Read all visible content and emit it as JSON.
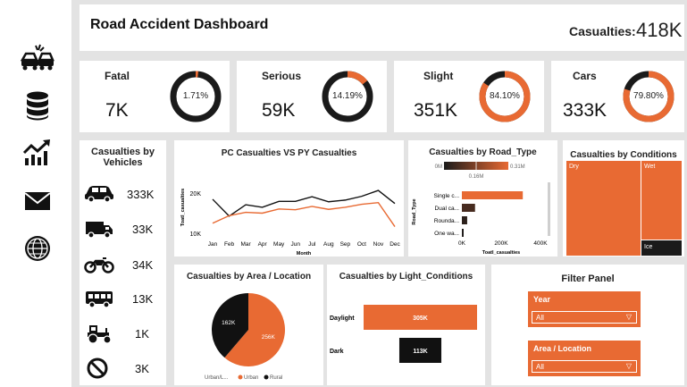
{
  "header": {
    "title": "Road Accident Dashboard",
    "casualties_label": "Casualties:",
    "casualties_value": "418K"
  },
  "nav": [
    "car-crash-icon",
    "database-icon",
    "chart-trend-icon",
    "mail-icon",
    "globe-icon"
  ],
  "kpis": [
    {
      "label": "Fatal",
      "value": "7K",
      "pct_label": "1.71%",
      "pct": 1.71
    },
    {
      "label": "Serious",
      "value": "59K",
      "pct_label": "14.19%",
      "pct": 14.19
    },
    {
      "label": "Slight",
      "value": "351K",
      "pct_label": "84.10%",
      "pct": 84.1
    },
    {
      "label": "Cars",
      "value": "333K",
      "pct_label": "79.80%",
      "pct": 79.8
    }
  ],
  "vehicles": {
    "title": "Casualties by Vehicles",
    "items": [
      {
        "icon": "car-icon",
        "value": "333K"
      },
      {
        "icon": "van-icon",
        "value": "33K"
      },
      {
        "icon": "motorcycle-icon",
        "value": "34K"
      },
      {
        "icon": "bus-icon",
        "value": "13K"
      },
      {
        "icon": "tractor-icon",
        "value": "1K"
      },
      {
        "icon": "no-entry-icon",
        "value": "3K"
      }
    ]
  },
  "filter": {
    "title": "Filter Panel",
    "year_label": "Year",
    "year_value": "All",
    "area_label": "Area / Location",
    "area_value": "All"
  },
  "colors": {
    "accent": "#e86a33",
    "dark": "#111111",
    "ring_bg": "#1a1a1a"
  },
  "chart_data": [
    {
      "type": "line",
      "title": "PC Casualties VS PY Casualties",
      "xlabel": "Month",
      "ylabel": "Toatl_casualties",
      "categories": [
        "Jan",
        "Feb",
        "Mar",
        "Apr",
        "May",
        "Jun",
        "Jul",
        "Aug",
        "Sep",
        "Oct",
        "Nov",
        "Dec"
      ],
      "yticks": [
        "20K",
        "10K"
      ],
      "ylim": [
        10000,
        24000
      ],
      "series": [
        {
          "color": "#111111",
          "values": [
            18500,
            14500,
            17200,
            16600,
            18000,
            18000,
            19100,
            17900,
            18300,
            19200,
            20600,
            17500
          ]
        },
        {
          "color": "#e86a33",
          "values": [
            12800,
            14600,
            15400,
            15200,
            16200,
            16000,
            16800,
            16100,
            16600,
            17300,
            17700,
            12000
          ]
        }
      ]
    },
    {
      "type": "bar",
      "title": "Casualties by Road_Type",
      "xlabel": "Toatl_casualties",
      "ylabel": "Road_Type",
      "categories": [
        "Single c...",
        "Dual ca...",
        "Rounda...",
        "One wa..."
      ],
      "values": [
        310000,
        67000,
        27000,
        9000
      ],
      "xticks": [
        "0K",
        "200K",
        "400K"
      ],
      "xlim": [
        0,
        400000
      ],
      "legend_min": "0M",
      "legend_max": "0.31M",
      "legend_mid": "0.16M"
    },
    {
      "type": "heatmap",
      "title": "Casualties by Conditions",
      "categories": [
        "Dry",
        "Wet",
        "Ice"
      ]
    },
    {
      "type": "pie",
      "title": "Casualties by Area / Location",
      "legend_title": "Urban/L...",
      "categories": [
        "Urban",
        "Rural"
      ],
      "values": [
        256,
        162
      ],
      "labels": [
        "256K",
        "162K"
      ],
      "colors": [
        "#e86a33",
        "#111111"
      ]
    },
    {
      "type": "bar",
      "title": "Casualties by Light_Conditions",
      "categories": [
        "Daylight",
        "Dark"
      ],
      "values": [
        305,
        113
      ],
      "labels": [
        "305K",
        "113K"
      ],
      "colors": [
        "#e86a33",
        "#111111"
      ]
    }
  ]
}
